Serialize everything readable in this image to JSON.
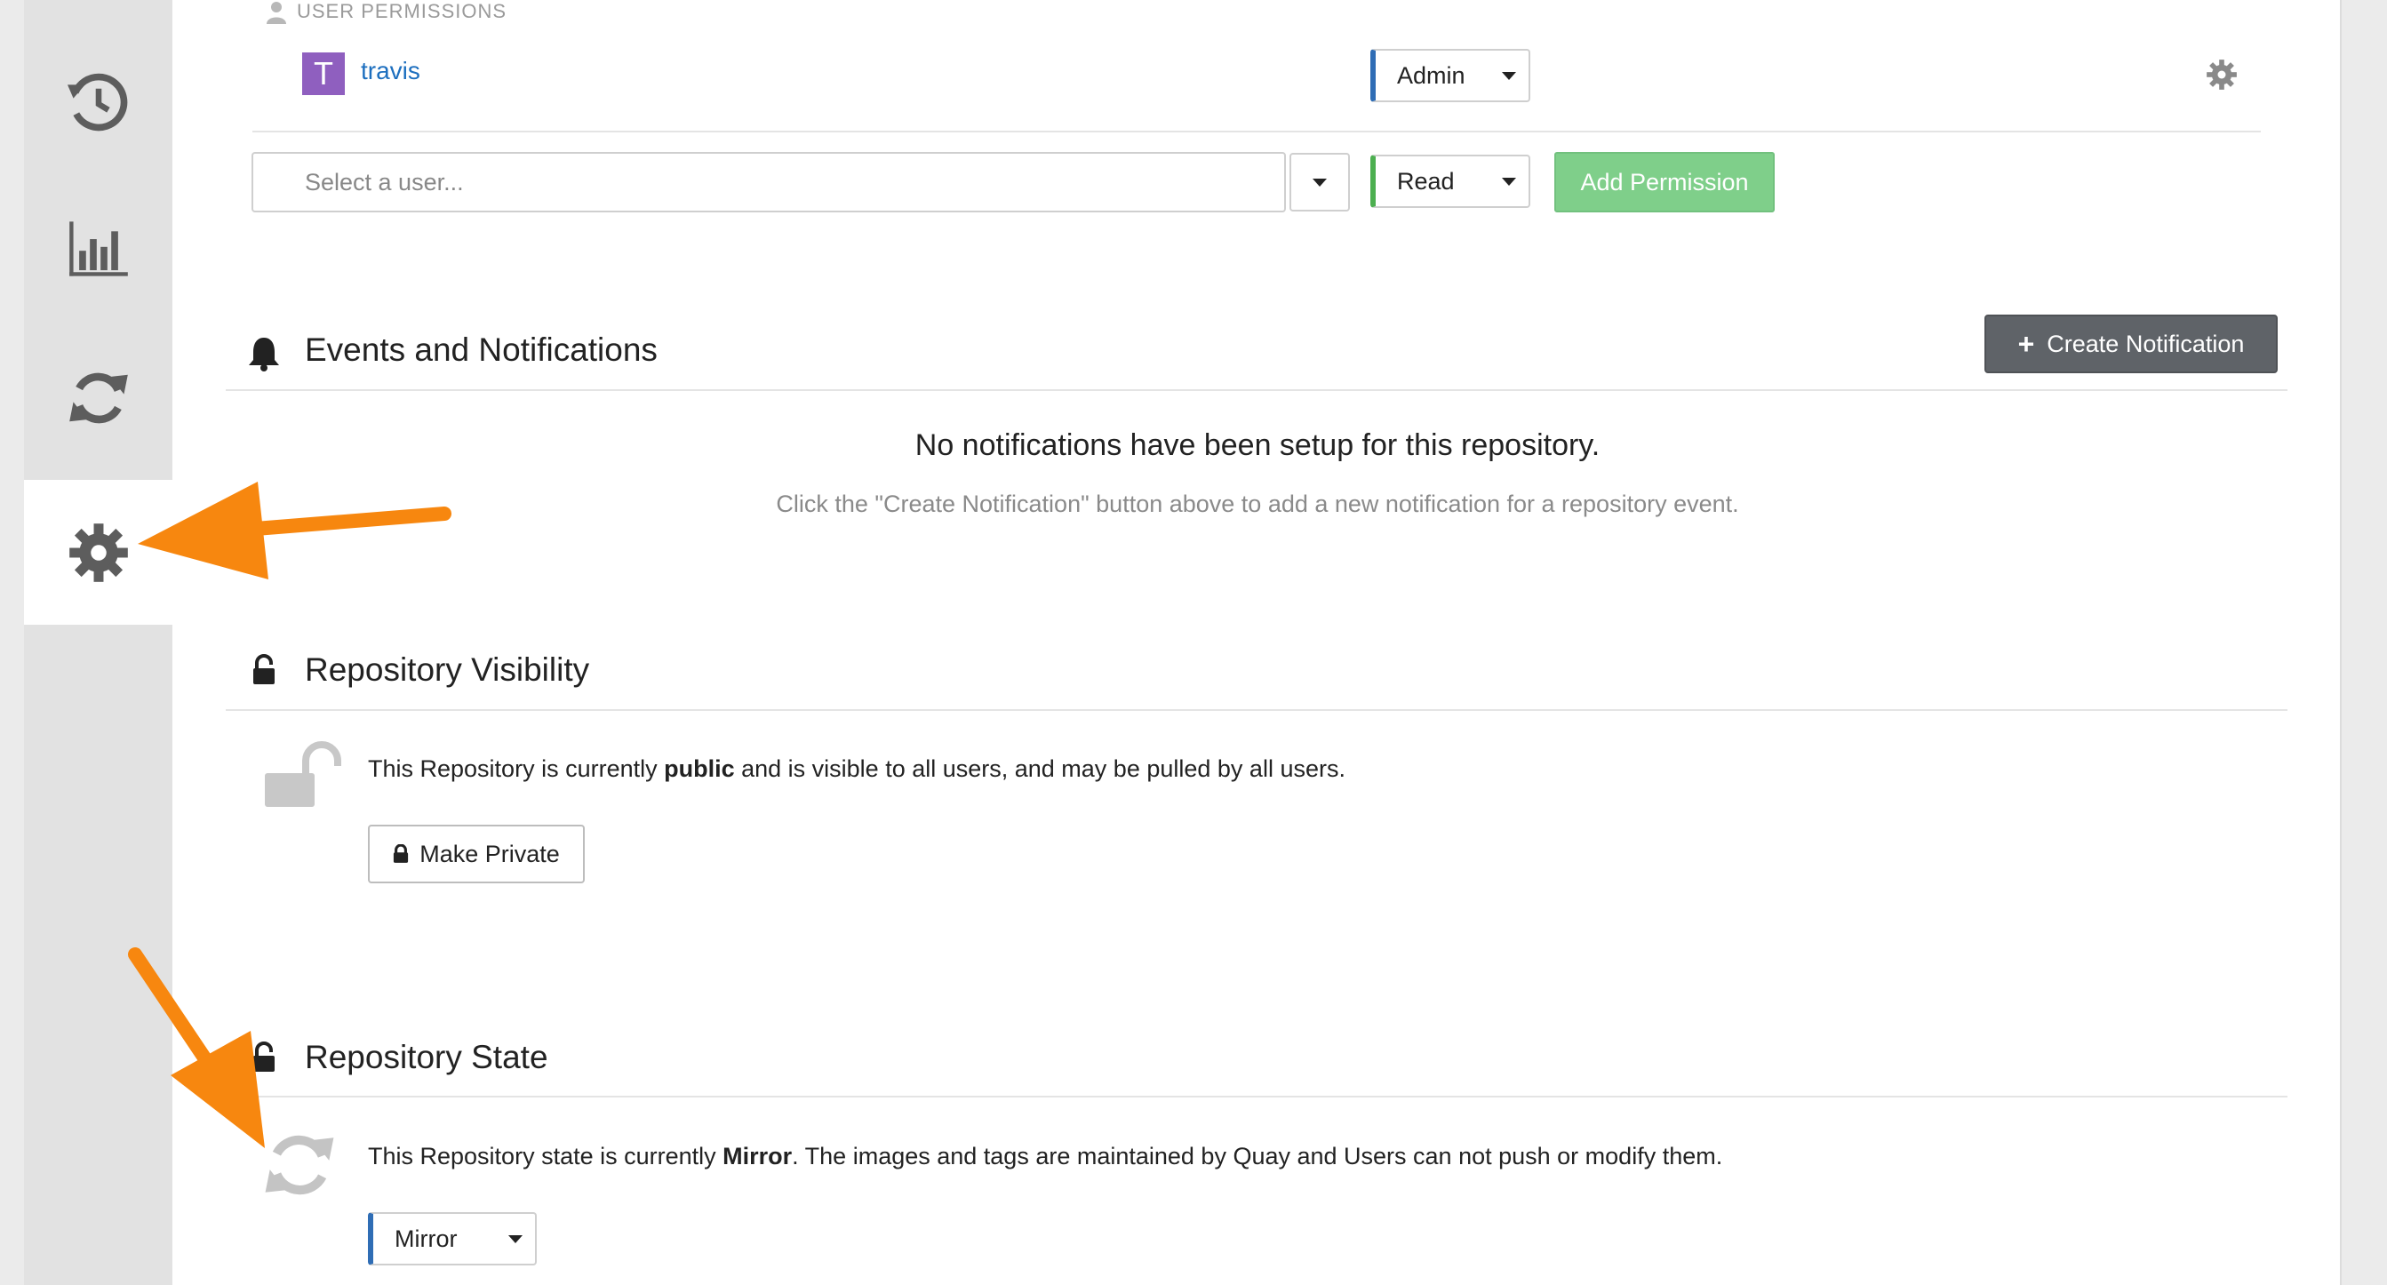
{
  "permissions": {
    "section_label": "USER PERMISSIONS",
    "user": {
      "avatar_letter": "T",
      "name": "travis",
      "role": "Admin"
    },
    "add": {
      "placeholder": "Select a user...",
      "role": "Read",
      "button": "Add Permission"
    }
  },
  "notifications": {
    "heading": "Events and Notifications",
    "create_button": "Create Notification",
    "empty_title": "No notifications have been setup for this repository.",
    "empty_hint": "Click the \"Create Notification\" button above to add a new notification for a repository event."
  },
  "visibility": {
    "heading": "Repository Visibility",
    "text_prefix": "This Repository is currently ",
    "state": "public",
    "text_suffix": " and is visible to all users, and may be pulled by all users.",
    "button": "Make Private"
  },
  "repo_state": {
    "heading": "Repository State",
    "text_prefix": "This Repository state is currently ",
    "state": "Mirror",
    "text_suffix": ". The images and tags are maintained by Quay and Users can not push or modify them.",
    "selected": "Mirror"
  },
  "colors": {
    "sidebar": "#e2e2e2",
    "avatar": "#8f5fbf",
    "link": "#1d6fbf",
    "admin_stripe": "#2f6db5",
    "read_stripe": "#4caf50",
    "add_button": "#7fcf8a",
    "create_button": "#5f6368",
    "annotation_arrow": "#f7870f"
  }
}
